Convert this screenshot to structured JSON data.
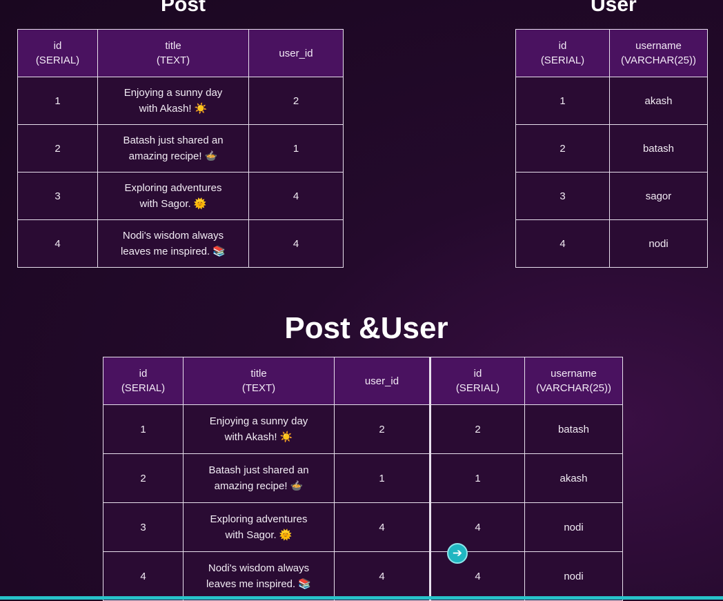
{
  "post_section": {
    "title": "Post",
    "headers": [
      {
        "line1": "id",
        "line2": "(SERIAL)"
      },
      {
        "line1": "title",
        "line2": "(TEXT)"
      },
      {
        "line1": "user_id",
        "line2": ""
      }
    ],
    "rows": [
      {
        "id": "1",
        "title_line1": "Enjoying a sunny day",
        "title_line2": "with Akash! ☀️",
        "user_id": "2"
      },
      {
        "id": "2",
        "title_line1": "Batash just shared an",
        "title_line2": "amazing recipe! 🍲",
        "user_id": "1"
      },
      {
        "id": "3",
        "title_line1": "Exploring adventures",
        "title_line2": "with Sagor. 🌞",
        "user_id": "4"
      },
      {
        "id": "4",
        "title_line1": "Nodi's wisdom always",
        "title_line2": "leaves me inspired. 📚",
        "user_id": "4"
      }
    ]
  },
  "user_section": {
    "title": "User",
    "headers": [
      {
        "line1": "id",
        "line2": "(SERIAL)"
      },
      {
        "line1": "username",
        "line2": "(VARCHAR(25))"
      }
    ],
    "rows": [
      {
        "id": "1",
        "username": "akash"
      },
      {
        "id": "2",
        "username": "batash"
      },
      {
        "id": "3",
        "username": "sagor"
      },
      {
        "id": "4",
        "username": "nodi"
      }
    ]
  },
  "join_section": {
    "title": "Post &User",
    "headers": [
      {
        "line1": "id",
        "line2": "(SERIAL)"
      },
      {
        "line1": "title",
        "line2": "(TEXT)"
      },
      {
        "line1": "user_id",
        "line2": ""
      },
      {
        "line1": "id",
        "line2": "(SERIAL)"
      },
      {
        "line1": "username",
        "line2": "(VARCHAR(25))"
      }
    ],
    "rows": [
      {
        "id": "1",
        "title_line1": "Enjoying a sunny day",
        "title_line2": "with Akash! ☀️",
        "user_id": "2",
        "user_pk": "2",
        "username": "batash"
      },
      {
        "id": "2",
        "title_line1": "Batash just shared an",
        "title_line2": "amazing recipe! 🍲",
        "user_id": "1",
        "user_pk": "1",
        "username": "akash"
      },
      {
        "id": "3",
        "title_line1": "Exploring adventures",
        "title_line2": "with Sagor. 🌞",
        "user_id": "4",
        "user_pk": "4",
        "username": "nodi"
      },
      {
        "id": "4",
        "title_line1": "Nodi's wisdom always",
        "title_line2": "leaves me inspired. 📚",
        "user_id": "4",
        "user_pk": "4",
        "username": "nodi"
      }
    ]
  },
  "overlay": {
    "cursor_icon": "arrow-right-circle-icon",
    "cursor_glyph": "➔",
    "accent_color": "#27c2c9"
  }
}
